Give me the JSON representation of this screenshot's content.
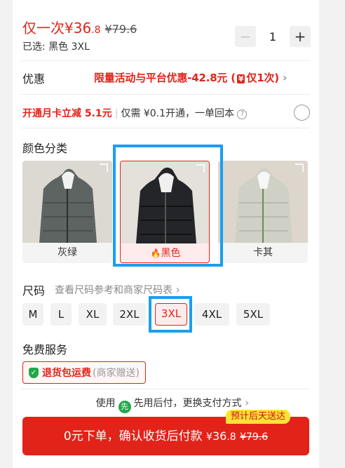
{
  "header": {
    "price_prefix": "仅一次",
    "price_currency": "¥",
    "price_int": "36",
    "price_dec": ".8",
    "original_price": "¥79.6",
    "selected_label": "已选: 黑色 3XL"
  },
  "quantity": {
    "minus": "−",
    "value": "1",
    "plus": "+"
  },
  "promo": {
    "label": "优惠",
    "text_before": "限量活动与平台优惠-42.8元 (",
    "tag": "¥",
    "text_after": "仅1次)",
    "chevron": "›"
  },
  "monthly_card": {
    "offer": "开通月卡立减 5.1元",
    "separator": "|",
    "desc": "仅需 ¥0.1开通，一单回本",
    "help": "?"
  },
  "colors": {
    "title": "颜色分类",
    "options": [
      {
        "label": "灰绿"
      },
      {
        "label": "黑色",
        "hot_icon": "🔥"
      },
      {
        "label": "卡其"
      }
    ]
  },
  "sizes": {
    "title": "尺码",
    "chart_link": "查看尺码参考和商家尺码表",
    "chevron": "›",
    "options": [
      "M",
      "L",
      "XL",
      "2XL",
      "3XL",
      "4XL",
      "5XL"
    ],
    "selected": "3XL"
  },
  "services": {
    "title": "免费服务",
    "badge_icon": "✓",
    "badge_main": "退货包运费",
    "badge_sub": "(商家赠送)"
  },
  "payment": {
    "use": "使用",
    "logo": "先",
    "method": "先用后付，更换支付方式",
    "chevron": "›"
  },
  "cta": {
    "eta_badge": "预计后天送达",
    "label": "0元下单，确认收货后付款",
    "price_currency": "¥",
    "price_int": "36",
    "price_dec": ".8",
    "original_price": "¥79.6"
  },
  "colors_palette": {
    "accent": "#e2231a",
    "highlight": "#1a9ef0",
    "green": "#21a84a",
    "badge_yellow": "#ffe135"
  }
}
